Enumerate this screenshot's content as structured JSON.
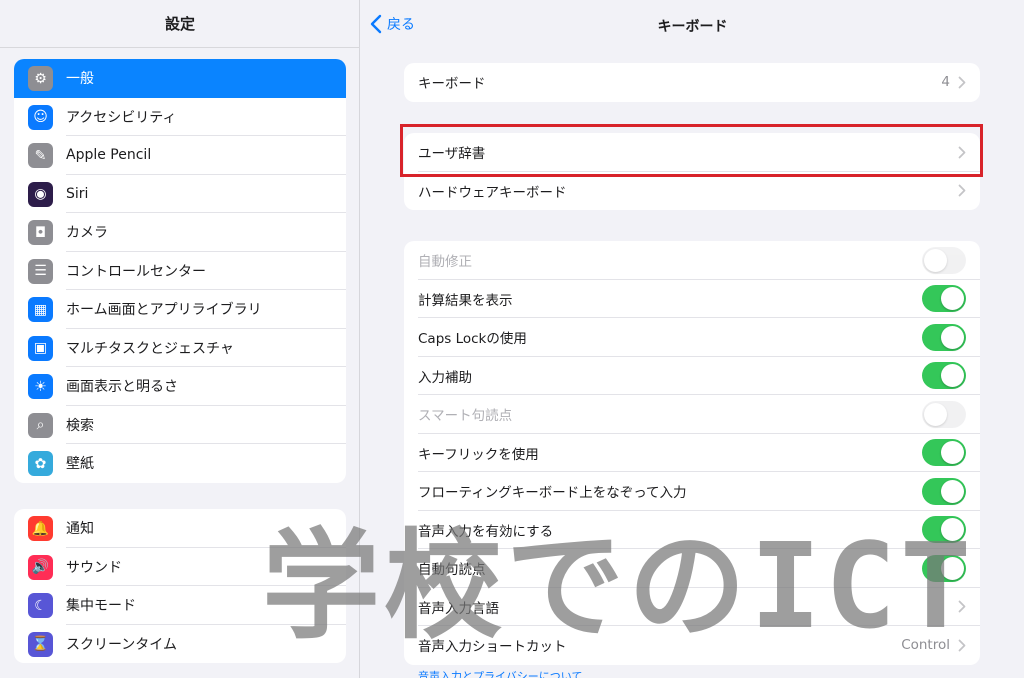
{
  "sidebar": {
    "title": "設定",
    "group1": [
      {
        "label": "一般",
        "icon": "gear-icon",
        "glyph": "⚙",
        "color": "#8e8e93",
        "selected": true
      },
      {
        "label": "アクセシビリティ",
        "icon": "accessibility-icon",
        "glyph": "☺",
        "color": "#0a7aff"
      },
      {
        "label": "Apple Pencil",
        "icon": "pencil-icon",
        "glyph": "✎",
        "color": "#8e8e93"
      },
      {
        "label": "Siri",
        "icon": "siri-icon",
        "glyph": "◉",
        "color": "#2d1d4a"
      },
      {
        "label": "カメラ",
        "icon": "camera-icon",
        "glyph": "◘",
        "color": "#8e8e93"
      },
      {
        "label": "コントロールセンター",
        "icon": "toggles-icon",
        "glyph": "☰",
        "color": "#8e8e93"
      },
      {
        "label": "ホーム画面とアプリライブラリ",
        "icon": "home-screen-icon",
        "glyph": "▦",
        "color": "#0a7aff"
      },
      {
        "label": "マルチタスクとジェスチャ",
        "icon": "multitask-icon",
        "glyph": "▣",
        "color": "#0a7aff"
      },
      {
        "label": "画面表示と明るさ",
        "icon": "sun-icon",
        "glyph": "☀",
        "color": "#0a7aff"
      },
      {
        "label": "検索",
        "icon": "search-icon",
        "glyph": "⌕",
        "color": "#8e8e93"
      },
      {
        "label": "壁紙",
        "icon": "wallpaper-icon",
        "glyph": "✿",
        "color": "#35aadc"
      }
    ],
    "group2": [
      {
        "label": "通知",
        "icon": "bell-icon",
        "glyph": "🔔",
        "color": "#ff3b30"
      },
      {
        "label": "サウンド",
        "icon": "speaker-icon",
        "glyph": "🔊",
        "color": "#ff2d55"
      },
      {
        "label": "集中モード",
        "icon": "moon-icon",
        "glyph": "☾",
        "color": "#5856d6"
      },
      {
        "label": "スクリーンタイム",
        "icon": "hourglass-icon",
        "glyph": "⌛",
        "color": "#5856d6"
      }
    ]
  },
  "nav": {
    "back_label": "戻る",
    "title": "キーボード"
  },
  "keyboards_row": {
    "label": "キーボード",
    "count": "4"
  },
  "dict_group": [
    {
      "label": "ユーザ辞書"
    },
    {
      "label": "ハードウェアキーボード"
    }
  ],
  "toggles": [
    {
      "label": "自動修正",
      "on": false,
      "disabled": true
    },
    {
      "label": "計算結果を表示",
      "on": true
    },
    {
      "label": "Caps Lockの使用",
      "on": true
    },
    {
      "label": "入力補助",
      "on": true
    },
    {
      "label": "スマート句読点",
      "on": false,
      "disabled": true
    },
    {
      "label": "キーフリックを使用",
      "on": true
    },
    {
      "label": "フローティングキーボード上をなぞって入力",
      "on": true
    },
    {
      "label": "音声入力を有効にする",
      "on": true
    },
    {
      "label": "自動句読点",
      "on": true
    }
  ],
  "voice_rows": [
    {
      "label": "音声入力言語",
      "value": ""
    },
    {
      "label": "音声入力ショートカット",
      "value": "Control"
    }
  ],
  "footer_link": "音声入力とプライバシーについて",
  "watermark": "学校でのICT",
  "colors": {
    "accent": "#0a7aff",
    "toggle_on": "#34c759",
    "highlight": "#d8232a"
  }
}
